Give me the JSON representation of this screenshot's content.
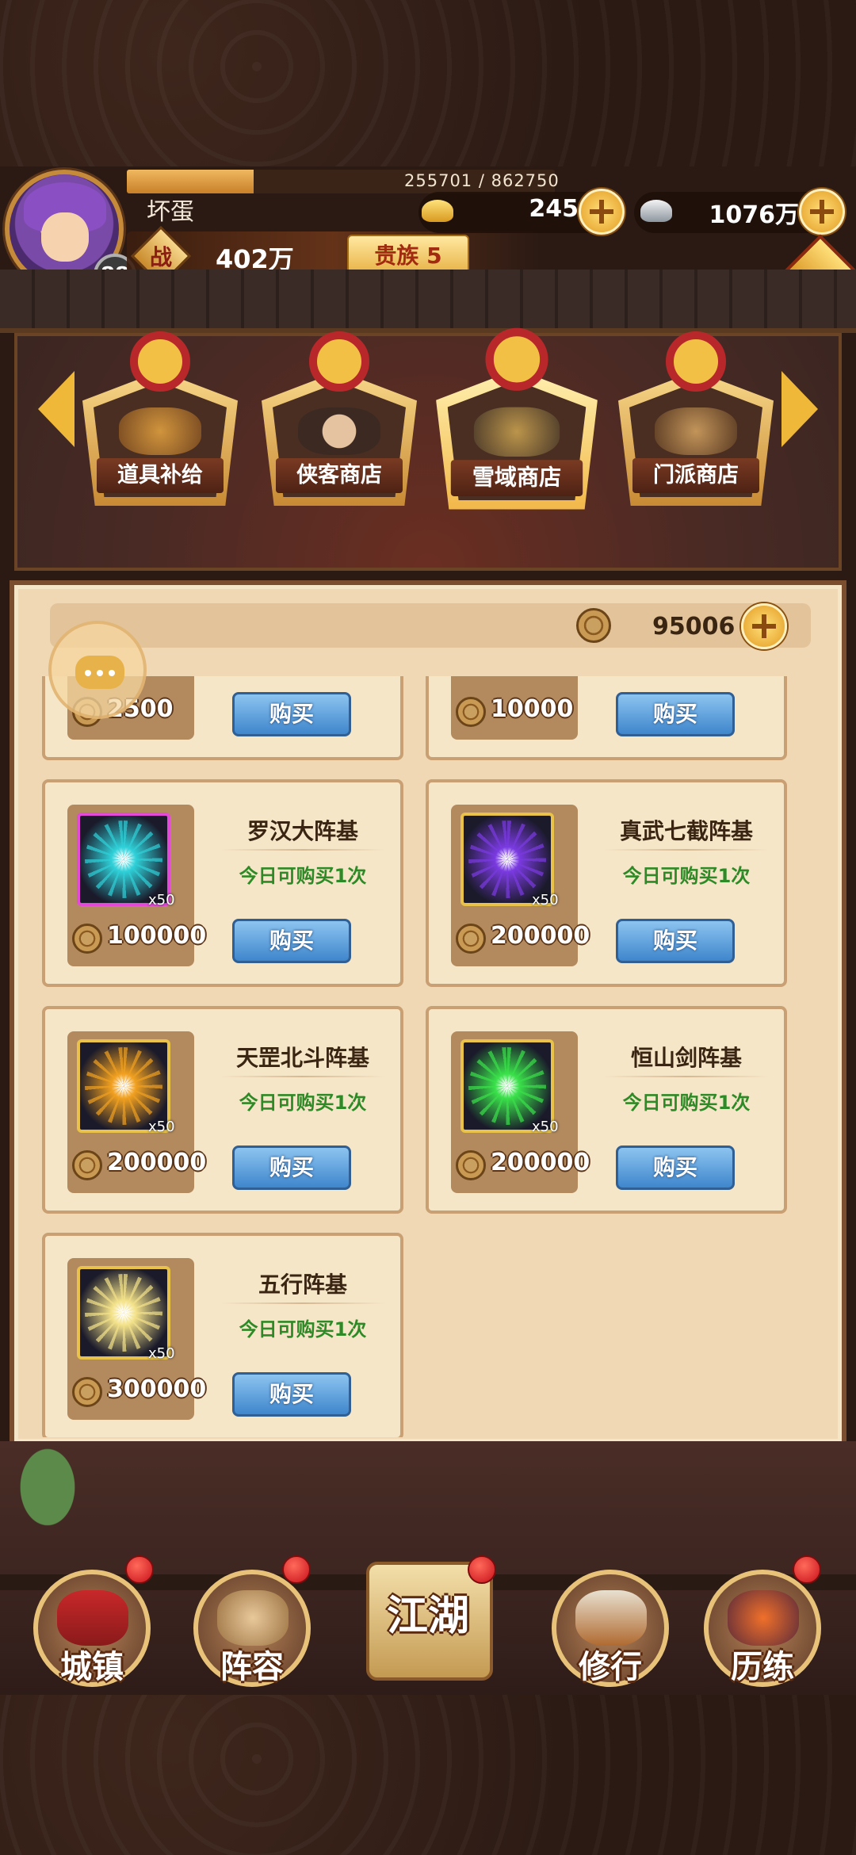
{
  "player": {
    "name": "坏蛋",
    "level": "88",
    "exp_text": "255701 / 862750",
    "exp_fraction": 0.296,
    "power_badge": "战",
    "power": "402万",
    "vip": "贵族 5",
    "gold": "245",
    "silver": "1076万"
  },
  "shop_tabs": [
    {
      "label": "道具补给",
      "active": false
    },
    {
      "label": "侠客商店",
      "active": false
    },
    {
      "label": "雪域商店",
      "active": true
    },
    {
      "label": "门派商店",
      "active": false
    }
  ],
  "shop_currency": "95006",
  "partial_items": [
    {
      "price": "2500",
      "buy": "购买"
    },
    {
      "price": "10000",
      "buy": "购买"
    }
  ],
  "items": [
    {
      "name": "罗汉大阵基",
      "limit": "今日可购买1次",
      "price": "100000",
      "qty": "x50",
      "buy": "购买",
      "color": "#2fd0d8",
      "frame": "#e34ad8"
    },
    {
      "name": "真武七截阵基",
      "limit": "今日可购买1次",
      "price": "200000",
      "qty": "x50",
      "buy": "购买",
      "color": "#7a3ae0",
      "frame": "#e8c24a"
    },
    {
      "name": "天罡北斗阵基",
      "limit": "今日可购买1次",
      "price": "200000",
      "qty": "x50",
      "buy": "购买",
      "color": "#f0a020",
      "frame": "#e8c24a"
    },
    {
      "name": "恒山剑阵基",
      "limit": "今日可购买1次",
      "price": "200000",
      "qty": "x50",
      "buy": "购买",
      "color": "#3ae04a",
      "frame": "#e8c24a"
    },
    {
      "name": "五行阵基",
      "limit": "今日可购买1次",
      "price": "300000",
      "qty": "x50",
      "buy": "购买",
      "color": "#f3e28a",
      "frame": "#e8c24a"
    }
  ],
  "nav": [
    {
      "label": "城镇",
      "badge": true
    },
    {
      "label": "阵容",
      "badge": true
    },
    {
      "label": "江湖",
      "badge": true
    },
    {
      "label": "修行",
      "badge": false
    },
    {
      "label": "历练",
      "badge": true
    }
  ],
  "colors": {
    "accent_gold": "#f0b838",
    "buy_blue": "#3f86cc",
    "limit_green": "#2e8a26",
    "badge_red": "#c8101a"
  }
}
